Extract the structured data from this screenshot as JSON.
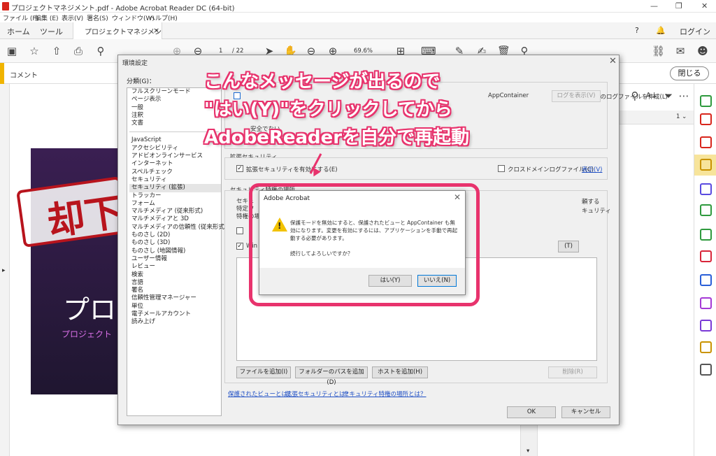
{
  "window": {
    "title": "プロジェクトマネジメント.pdf - Adobe Acrobat Reader DC (64-bit)"
  },
  "menu": [
    "ファイル (F)",
    "編集 (E)",
    "表示(V)",
    "署名(S)",
    "ウィンドウ(W)",
    "ヘルプ(H)"
  ],
  "tabs": {
    "home": "ホーム",
    "tools": "ツール",
    "doc": "プロジェクトマネジメント...",
    "login": "ログイン"
  },
  "toolbar": {
    "page_current": "1",
    "page_total": "/ 22",
    "zoom": "69.6%"
  },
  "comment_bar": {
    "label": "コメント",
    "close": "閉じる"
  },
  "document": {
    "stamp": "却下",
    "slide_title": "プロ",
    "slide_sub": "プロジェクト"
  },
  "prefs": {
    "title": "環境設定",
    "category_label": "分類(G)：",
    "categories_top": [
      "フルスクリーンモード",
      "ページ表示",
      "一般",
      "注釈",
      "文書"
    ],
    "categories_bottom": [
      "JavaScript",
      "アクセシビリティ",
      "アドビオンラインサービス",
      "インターネット",
      "スペルチェック",
      "セキュリティ",
      "セキュリティ (拡張)",
      "トラッカー",
      "フォーム",
      "マルチメディア (従来形式)",
      "マルチメディアと 3D",
      "マルチメディアの信頼性 (従来形式)",
      "ものさし (2D)",
      "ものさし (3D)",
      "ものさし (地図情報)",
      "ユーザー情報",
      "レビュー",
      "検索",
      "言語",
      "署名",
      "信頼性管理マネージャー",
      "単位",
      "電子メールアカウント",
      "読み上げ"
    ],
    "selected_category": "セキュリティ (拡張)",
    "protected_log": "保護モードのログファイルを作成(L)",
    "view_log": "ログを表示(V)",
    "appcontainer": "AppContainer",
    "unsafe_text": "安全でない",
    "enhanced_security_heading": "拡張セキュリティ",
    "enhanced_security_check": "拡張セキュリティを有効にする(E)",
    "cross_domain": "クロスドメインログファイル(C)",
    "display": "表示(V)",
    "privileged_heading": "セキュリティ特権の場所",
    "priv_left": [
      "セキュ",
      "特定フ",
      "特権の場"
    ],
    "priv_right": [
      "頼する",
      "キュリティ"
    ],
    "win_label": "Win O",
    "t_button": "(T)",
    "add_file": "ファイルを追加(I)",
    "add_folder": "フォルダーのパスを追加(D)",
    "add_host": "ホストを追加(H)",
    "delete": "削除(R)",
    "link_protected": "保護されたビューとは？",
    "link_enhanced": "拡張セキュリティとは？",
    "link_privileged": "セキュリティ特権の場所とは？",
    "ok": "OK",
    "cancel": "キャンセル"
  },
  "dialog": {
    "title": "Adobe Acrobat",
    "message": "保護モードを無効にすると、保護されたビューと AppContainer も無効になります。変更を有効にするには、アプリケーションを手動で再起動する必要があります。",
    "confirm": "続行してよろしいですか？",
    "yes": "はい(Y)",
    "no": "いいえ(N)"
  },
  "annotation": {
    "line1": "こんなメッセージが出るので",
    "line2": "\"はい(Y)\"をクリックしてから",
    "line3": "AdobeReaderを自分で再起動",
    "color": "#e8336d"
  }
}
